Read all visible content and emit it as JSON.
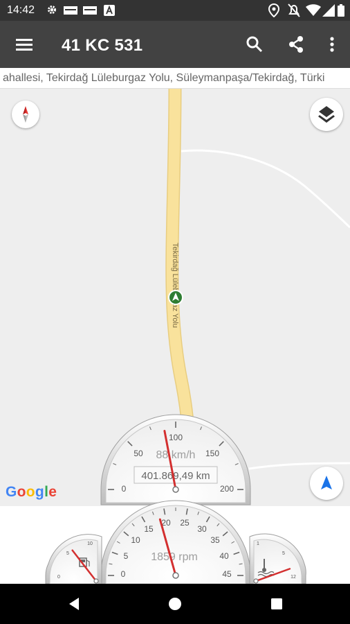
{
  "status_bar": {
    "time": "14:42",
    "icons": [
      "settings-icon",
      "sim-icon",
      "sim-icon",
      "a-badge-icon",
      "location-icon",
      "notifications-off-icon",
      "wifi-icon",
      "signal-icon",
      "battery-icon"
    ]
  },
  "app_bar": {
    "title": "41 KC 531",
    "icons": [
      "menu-icon",
      "search-icon",
      "share-icon",
      "more-vert-icon"
    ]
  },
  "address": {
    "text": "ahallesi, Tekirdağ Lüleburgaz Yolu, Süleymanpaşa/Tekirdağ, Türki"
  },
  "map": {
    "road_label": "Tekirdağ Lüleburgaz Yolu",
    "attribution": "Google",
    "road_color": "#f9e29c",
    "marker_color": "#2e7d32",
    "accent": "#1a73e8"
  },
  "speedometer": {
    "ticks": [
      "0",
      "50",
      "100",
      "150",
      "200"
    ],
    "speed_text": "88 km/h",
    "odometer": "401.869,49 km",
    "needle_value": 88,
    "max": 200
  },
  "tachometer": {
    "ticks": [
      "0",
      "5",
      "10",
      "15",
      "20",
      "25",
      "30",
      "35",
      "40",
      "45"
    ],
    "rpm_text": "1859 rpm",
    "needle_value": 18.59,
    "max": 45
  },
  "fuel_gauge": {
    "ticks": [
      "0",
      "5",
      "10"
    ],
    "icon": "fuel-icon",
    "needle_fraction": 0.58
  },
  "temp_gauge": {
    "ticks": [
      "1",
      "5",
      "12"
    ],
    "icon": "coolant-temp-icon",
    "needle_fraction": 0.78
  },
  "nav_bar": {
    "icons": [
      "back-icon",
      "home-icon",
      "recents-icon"
    ]
  }
}
